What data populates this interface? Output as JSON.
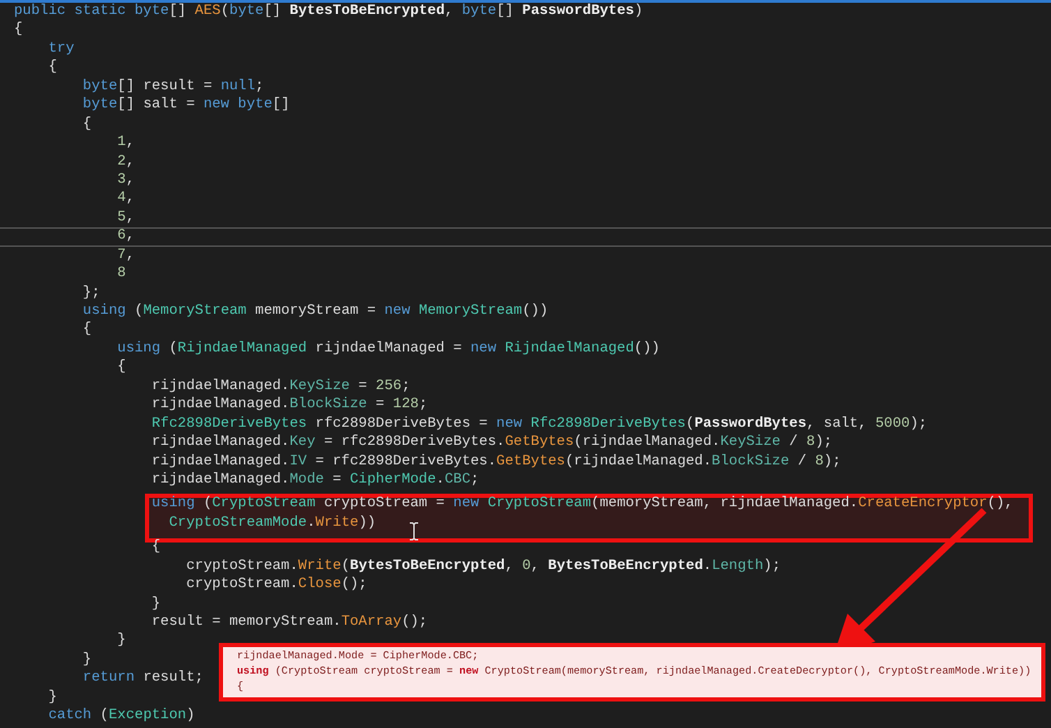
{
  "editor": {
    "lines": [
      {
        "current": false,
        "tokens": [
          {
            "kind": "keyword",
            "text": "public static byte"
          },
          {
            "kind": "plain",
            "text": "[] "
          },
          {
            "kind": "method",
            "text": "AES"
          },
          {
            "kind": "plain",
            "text": "("
          },
          {
            "kind": "keyword",
            "text": "byte"
          },
          {
            "kind": "plain",
            "text": "[] "
          },
          {
            "kind": "param",
            "text": "BytesToBeEncrypted"
          },
          {
            "kind": "plain",
            "text": ", "
          },
          {
            "kind": "keyword",
            "text": "byte"
          },
          {
            "kind": "plain",
            "text": "[] "
          },
          {
            "kind": "param",
            "text": "PasswordBytes"
          },
          {
            "kind": "plain",
            "text": ")"
          }
        ]
      },
      {
        "current": false,
        "tokens": [
          {
            "kind": "plain",
            "text": "{"
          }
        ]
      },
      {
        "current": false,
        "tokens": [
          {
            "kind": "keyword",
            "text": "    try"
          }
        ]
      },
      {
        "current": false,
        "tokens": [
          {
            "kind": "plain",
            "text": "    {"
          }
        ]
      },
      {
        "current": false,
        "tokens": [
          {
            "kind": "keyword",
            "text": "        byte"
          },
          {
            "kind": "plain",
            "text": "[] result = "
          },
          {
            "kind": "keyword",
            "text": "null"
          },
          {
            "kind": "plain",
            "text": ";"
          }
        ]
      },
      {
        "current": false,
        "tokens": [
          {
            "kind": "keyword",
            "text": "        byte"
          },
          {
            "kind": "plain",
            "text": "[] salt = "
          },
          {
            "kind": "keyword",
            "text": "new byte"
          },
          {
            "kind": "plain",
            "text": "[]"
          }
        ]
      },
      {
        "current": false,
        "tokens": [
          {
            "kind": "plain",
            "text": "        {"
          }
        ]
      },
      {
        "current": false,
        "tokens": [
          {
            "kind": "number",
            "text": "            1"
          },
          {
            "kind": "plain",
            "text": ","
          }
        ]
      },
      {
        "current": false,
        "tokens": [
          {
            "kind": "number",
            "text": "            2"
          },
          {
            "kind": "plain",
            "text": ","
          }
        ]
      },
      {
        "current": false,
        "tokens": [
          {
            "kind": "number",
            "text": "            3"
          },
          {
            "kind": "plain",
            "text": ","
          }
        ]
      },
      {
        "current": false,
        "tokens": [
          {
            "kind": "number",
            "text": "            4"
          },
          {
            "kind": "plain",
            "text": ","
          }
        ]
      },
      {
        "current": false,
        "tokens": [
          {
            "kind": "number",
            "text": "            5"
          },
          {
            "kind": "plain",
            "text": ","
          }
        ]
      },
      {
        "current": true,
        "tokens": [
          {
            "kind": "number",
            "text": "            6"
          },
          {
            "kind": "plain",
            "text": ","
          }
        ]
      },
      {
        "current": false,
        "tokens": [
          {
            "kind": "number",
            "text": "            7"
          },
          {
            "kind": "plain",
            "text": ","
          }
        ]
      },
      {
        "current": false,
        "tokens": [
          {
            "kind": "number",
            "text": "            8"
          }
        ]
      },
      {
        "current": false,
        "tokens": [
          {
            "kind": "plain",
            "text": "        };"
          }
        ]
      },
      {
        "current": false,
        "tokens": [
          {
            "kind": "keyword",
            "text": "        using"
          },
          {
            "kind": "plain",
            "text": " ("
          },
          {
            "kind": "type",
            "text": "MemoryStream"
          },
          {
            "kind": "plain",
            "text": " memoryStream = "
          },
          {
            "kind": "keyword",
            "text": "new "
          },
          {
            "kind": "type",
            "text": "MemoryStream"
          },
          {
            "kind": "plain",
            "text": "())"
          }
        ]
      },
      {
        "current": false,
        "tokens": [
          {
            "kind": "plain",
            "text": "        {"
          }
        ]
      },
      {
        "current": false,
        "tokens": [
          {
            "kind": "keyword",
            "text": "            using"
          },
          {
            "kind": "plain",
            "text": " ("
          },
          {
            "kind": "type",
            "text": "RijndaelManaged"
          },
          {
            "kind": "plain",
            "text": " rijndaelManaged = "
          },
          {
            "kind": "keyword",
            "text": "new "
          },
          {
            "kind": "type",
            "text": "RijndaelManaged"
          },
          {
            "kind": "plain",
            "text": "())"
          }
        ]
      },
      {
        "current": false,
        "tokens": [
          {
            "kind": "plain",
            "text": "            {"
          }
        ]
      },
      {
        "current": false,
        "tokens": [
          {
            "kind": "plain",
            "text": "                rijndaelManaged."
          },
          {
            "kind": "property",
            "text": "KeySize"
          },
          {
            "kind": "plain",
            "text": " = "
          },
          {
            "kind": "number",
            "text": "256"
          },
          {
            "kind": "plain",
            "text": ";"
          }
        ]
      },
      {
        "current": false,
        "tokens": [
          {
            "kind": "plain",
            "text": "                rijndaelManaged."
          },
          {
            "kind": "property",
            "text": "BlockSize"
          },
          {
            "kind": "plain",
            "text": " = "
          },
          {
            "kind": "number",
            "text": "128"
          },
          {
            "kind": "plain",
            "text": ";"
          }
        ]
      },
      {
        "current": false,
        "tokens": [
          {
            "kind": "type",
            "text": "                Rfc2898DeriveBytes"
          },
          {
            "kind": "plain",
            "text": " rfc2898DeriveBytes = "
          },
          {
            "kind": "keyword",
            "text": "new "
          },
          {
            "kind": "type",
            "text": "Rfc2898DeriveBytes"
          },
          {
            "kind": "plain",
            "text": "("
          },
          {
            "kind": "param",
            "text": "PasswordBytes"
          },
          {
            "kind": "plain",
            "text": ", salt, "
          },
          {
            "kind": "number",
            "text": "5000"
          },
          {
            "kind": "plain",
            "text": ");"
          }
        ]
      },
      {
        "current": false,
        "tokens": [
          {
            "kind": "plain",
            "text": "                rijndaelManaged."
          },
          {
            "kind": "property",
            "text": "Key"
          },
          {
            "kind": "plain",
            "text": " = rfc2898DeriveBytes."
          },
          {
            "kind": "method",
            "text": "GetBytes"
          },
          {
            "kind": "plain",
            "text": "(rijndaelManaged."
          },
          {
            "kind": "property",
            "text": "KeySize"
          },
          {
            "kind": "plain",
            "text": " / "
          },
          {
            "kind": "number",
            "text": "8"
          },
          {
            "kind": "plain",
            "text": ");"
          }
        ]
      },
      {
        "current": false,
        "tokens": [
          {
            "kind": "plain",
            "text": "                rijndaelManaged."
          },
          {
            "kind": "property",
            "text": "IV"
          },
          {
            "kind": "plain",
            "text": " = rfc2898DeriveBytes."
          },
          {
            "kind": "method",
            "text": "GetBytes"
          },
          {
            "kind": "plain",
            "text": "(rijndaelManaged."
          },
          {
            "kind": "property",
            "text": "BlockSize"
          },
          {
            "kind": "plain",
            "text": " / "
          },
          {
            "kind": "number",
            "text": "8"
          },
          {
            "kind": "plain",
            "text": ");"
          }
        ]
      },
      {
        "current": false,
        "tokens": [
          {
            "kind": "plain",
            "text": "                rijndaelManaged."
          },
          {
            "kind": "property",
            "text": "Mode"
          },
          {
            "kind": "plain",
            "text": " = "
          },
          {
            "kind": "type",
            "text": "CipherMode"
          },
          {
            "kind": "plain",
            "text": "."
          },
          {
            "kind": "property",
            "text": "CBC"
          },
          {
            "kind": "plain",
            "text": ";"
          }
        ]
      },
      {
        "current": false,
        "tokens": [
          {
            "kind": "keyword",
            "text": "                using"
          },
          {
            "kind": "plain",
            "text": " ("
          },
          {
            "kind": "type",
            "text": "CryptoStream"
          },
          {
            "kind": "plain",
            "text": " cryptoStream = "
          },
          {
            "kind": "keyword",
            "text": "new "
          },
          {
            "kind": "type",
            "text": "CryptoStream"
          },
          {
            "kind": "plain",
            "text": "(memoryStream, rijndaelManaged."
          },
          {
            "kind": "method",
            "text": "CreateEncryptor"
          },
          {
            "kind": "plain",
            "text": "(),"
          }
        ]
      },
      {
        "current": false,
        "tokens": [
          {
            "kind": "type",
            "text": "                  CryptoStreamMode"
          },
          {
            "kind": "plain",
            "text": "."
          },
          {
            "kind": "method",
            "text": "Write"
          },
          {
            "kind": "plain",
            "text": "))"
          }
        ]
      },
      {
        "current": false,
        "tokens": [
          {
            "kind": "plain",
            "text": "                {"
          }
        ]
      },
      {
        "current": false,
        "tokens": [
          {
            "kind": "plain",
            "text": "                    cryptoStream."
          },
          {
            "kind": "method",
            "text": "Write"
          },
          {
            "kind": "plain",
            "text": "("
          },
          {
            "kind": "param",
            "text": "BytesToBeEncrypted"
          },
          {
            "kind": "plain",
            "text": ", "
          },
          {
            "kind": "number",
            "text": "0"
          },
          {
            "kind": "plain",
            "text": ", "
          },
          {
            "kind": "param",
            "text": "BytesToBeEncrypted"
          },
          {
            "kind": "plain",
            "text": "."
          },
          {
            "kind": "property",
            "text": "Length"
          },
          {
            "kind": "plain",
            "text": ");"
          }
        ]
      },
      {
        "current": false,
        "tokens": [
          {
            "kind": "plain",
            "text": "                    cryptoStream."
          },
          {
            "kind": "method",
            "text": "Close"
          },
          {
            "kind": "plain",
            "text": "();"
          }
        ]
      },
      {
        "current": false,
        "tokens": [
          {
            "kind": "plain",
            "text": "                }"
          }
        ]
      },
      {
        "current": false,
        "tokens": [
          {
            "kind": "plain",
            "text": "                result = memoryStream."
          },
          {
            "kind": "method",
            "text": "ToArray"
          },
          {
            "kind": "plain",
            "text": "();"
          }
        ]
      },
      {
        "current": false,
        "tokens": [
          {
            "kind": "plain",
            "text": "            }"
          }
        ]
      },
      {
        "current": false,
        "tokens": [
          {
            "kind": "plain",
            "text": "        }"
          }
        ]
      },
      {
        "current": false,
        "tokens": [
          {
            "kind": "keyword",
            "text": "        return"
          },
          {
            "kind": "plain",
            "text": " result;"
          }
        ]
      },
      {
        "current": false,
        "tokens": [
          {
            "kind": "plain",
            "text": "    }"
          }
        ]
      },
      {
        "current": false,
        "tokens": [
          {
            "kind": "keyword",
            "text": "    catch"
          },
          {
            "kind": "plain",
            "text": " ("
          },
          {
            "kind": "type",
            "text": "Exception"
          },
          {
            "kind": "plain",
            "text": ")"
          }
        ]
      }
    ]
  },
  "inset": {
    "lines": [
      {
        "tokens": [
          {
            "kind": "plain",
            "text": "rijndaelManaged.Mode = CipherMode.CBC;"
          }
        ]
      },
      {
        "tokens": [
          {
            "kind": "keyword",
            "text": "using"
          },
          {
            "kind": "plain",
            "text": " (CryptoStream cryptoStream = "
          },
          {
            "kind": "keyword",
            "text": "new"
          },
          {
            "kind": "plain",
            "text": " CryptoStream(memoryStream, rijndaelManaged.CreateDecryptor(), CryptoStreamMode.Write))"
          }
        ]
      },
      {
        "tokens": [
          {
            "kind": "plain",
            "text": "{"
          }
        ]
      }
    ]
  }
}
